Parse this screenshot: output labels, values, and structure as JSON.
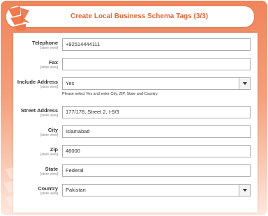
{
  "header": {
    "title": "Create Local Business Schema Tags (3/3)"
  },
  "fields": [
    {
      "label": "Telephone",
      "scope": "[store view]",
      "value": "+92514444111",
      "type": "text"
    },
    {
      "label": "Fax",
      "scope": "[store view]",
      "value": "",
      "type": "text"
    },
    {
      "label": "Include Address",
      "scope": "[store view]",
      "value": "Yes",
      "type": "select",
      "note": "Please select Yes and enter City, ZIP, State and Country."
    },
    {
      "label": "Street Address",
      "scope": "[store view]",
      "value": "177/178, Street 2, I-9/3",
      "type": "text"
    },
    {
      "label": "City",
      "scope": "[store view]",
      "value": "Islamabad",
      "type": "text"
    },
    {
      "label": "Zip",
      "scope": "[store view]",
      "value": "46000",
      "type": "text"
    },
    {
      "label": "State",
      "scope": "[store view]",
      "value": "Federal",
      "type": "text"
    },
    {
      "label": "Country",
      "scope": "[store view]",
      "value": "Pakistan",
      "type": "select"
    }
  ],
  "colors": {
    "accent": "#e0683a",
    "background_top": "#f0845a"
  },
  "icons": {
    "logo": "brand-logo-icon",
    "select": "chevron-down-icon"
  }
}
